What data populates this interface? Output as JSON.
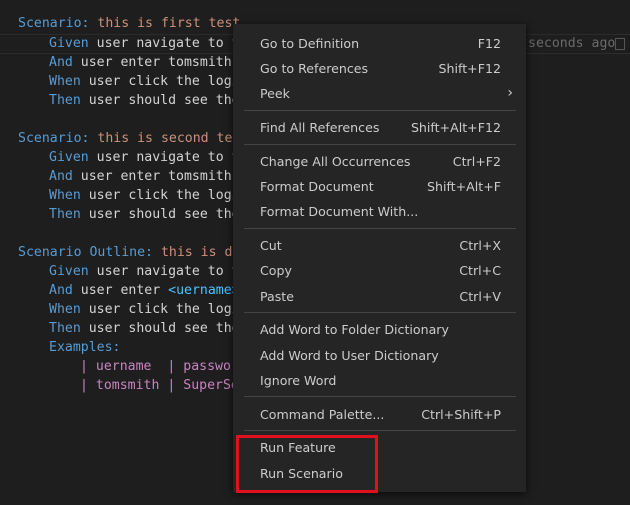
{
  "editor": {
    "blame_text": "seconds ago",
    "scenarios": [
      {
        "keyword": "Scenario:",
        "title": "this is first test",
        "steps": [
          {
            "kw": "Given",
            "text": "user navigate to t"
          },
          {
            "kw": "And",
            "text": "user enter tomsmith"
          },
          {
            "kw": "When",
            "text": "user click the logi"
          },
          {
            "kw": "Then",
            "text": "user should see the"
          }
        ]
      },
      {
        "keyword": "Scenario:",
        "title": "this is second tes",
        "steps": [
          {
            "kw": "Given",
            "text": "user navigate to t"
          },
          {
            "kw": "And",
            "text": "user enter tomsmith"
          },
          {
            "kw": "When",
            "text": "user click the logi"
          },
          {
            "kw": "Then",
            "text": "user should see the"
          }
        ]
      },
      {
        "keyword": "Scenario Outline:",
        "title": "this is da",
        "steps": [
          {
            "kw": "Given",
            "text": "user navigate to t"
          },
          {
            "kw": "And",
            "text": "user enter ",
            "param": "<uername>"
          },
          {
            "kw": "When",
            "text": "user click the logi"
          },
          {
            "kw": "Then",
            "text": "user should see the"
          }
        ]
      }
    ],
    "examples_keyword": "Examples:",
    "table": [
      {
        "c1": "uername ",
        "c2": "passwor"
      },
      {
        "c1": "tomsmith",
        "c2": "SuperSe"
      }
    ]
  },
  "context_menu": {
    "items": [
      {
        "label": "Go to Definition",
        "key": "F12"
      },
      {
        "label": "Go to References",
        "key": "Shift+F12"
      },
      {
        "label": "Peek",
        "key": ""
      },
      {
        "label": "Find All References",
        "key": "Shift+Alt+F12"
      },
      {
        "label": "Change All Occurrences",
        "key": "Ctrl+F2"
      },
      {
        "label": "Format Document",
        "key": "Shift+Alt+F"
      },
      {
        "label": "Format Document With...",
        "key": ""
      },
      {
        "label": "Cut",
        "key": "Ctrl+X"
      },
      {
        "label": "Copy",
        "key": "Ctrl+C"
      },
      {
        "label": "Paste",
        "key": "Ctrl+V"
      },
      {
        "label": "Add Word to Folder Dictionary",
        "key": ""
      },
      {
        "label": "Add Word to User Dictionary",
        "key": ""
      },
      {
        "label": "Ignore Word",
        "key": ""
      },
      {
        "label": "Command Palette...",
        "key": "Ctrl+Shift+P"
      },
      {
        "label": "Run Feature",
        "key": ""
      },
      {
        "label": "Run Scenario",
        "key": ""
      }
    ]
  },
  "colors": {
    "highlight_box": "#e0101c",
    "keyword": "#569cd6",
    "title": "#ce9178"
  }
}
